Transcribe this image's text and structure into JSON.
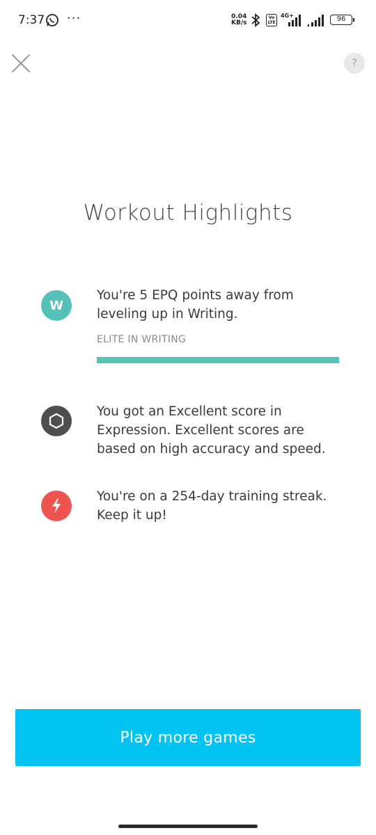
{
  "status_bar": {
    "time": "7:37",
    "dots": "···",
    "speed_value": "0.04",
    "speed_unit": "KB/s",
    "volte_line1": "Vo",
    "volte_line2": "LTE",
    "network": "4G+",
    "battery": "96"
  },
  "header": {
    "close_icon": "close-icon",
    "help_label": "?"
  },
  "title": "Workout Highlights",
  "highlights": [
    {
      "icon": "letter-w-badge-icon",
      "icon_letter": "W",
      "icon_color": "#55c1b8",
      "text_line1": "You're 5 EPQ points away from",
      "text_line2": "leveling up in Writing.",
      "level_label": "ELITE IN WRITING",
      "progress_fraction": 1.0
    },
    {
      "icon": "hexagon-icon",
      "icon_color": "#4e4e4e",
      "text_line1": "You got an Excellent score in",
      "text_line2": "Expression. Excellent scores are",
      "text_line3": "based on high accuracy and speed."
    },
    {
      "icon": "lightning-bolt-icon",
      "icon_color": "#ef5350",
      "text_line1": "You're on a 254-day training streak.",
      "text_line2": "Keep it up!"
    }
  ],
  "cta": {
    "label": "Play more games",
    "color": "#03c3f3"
  }
}
